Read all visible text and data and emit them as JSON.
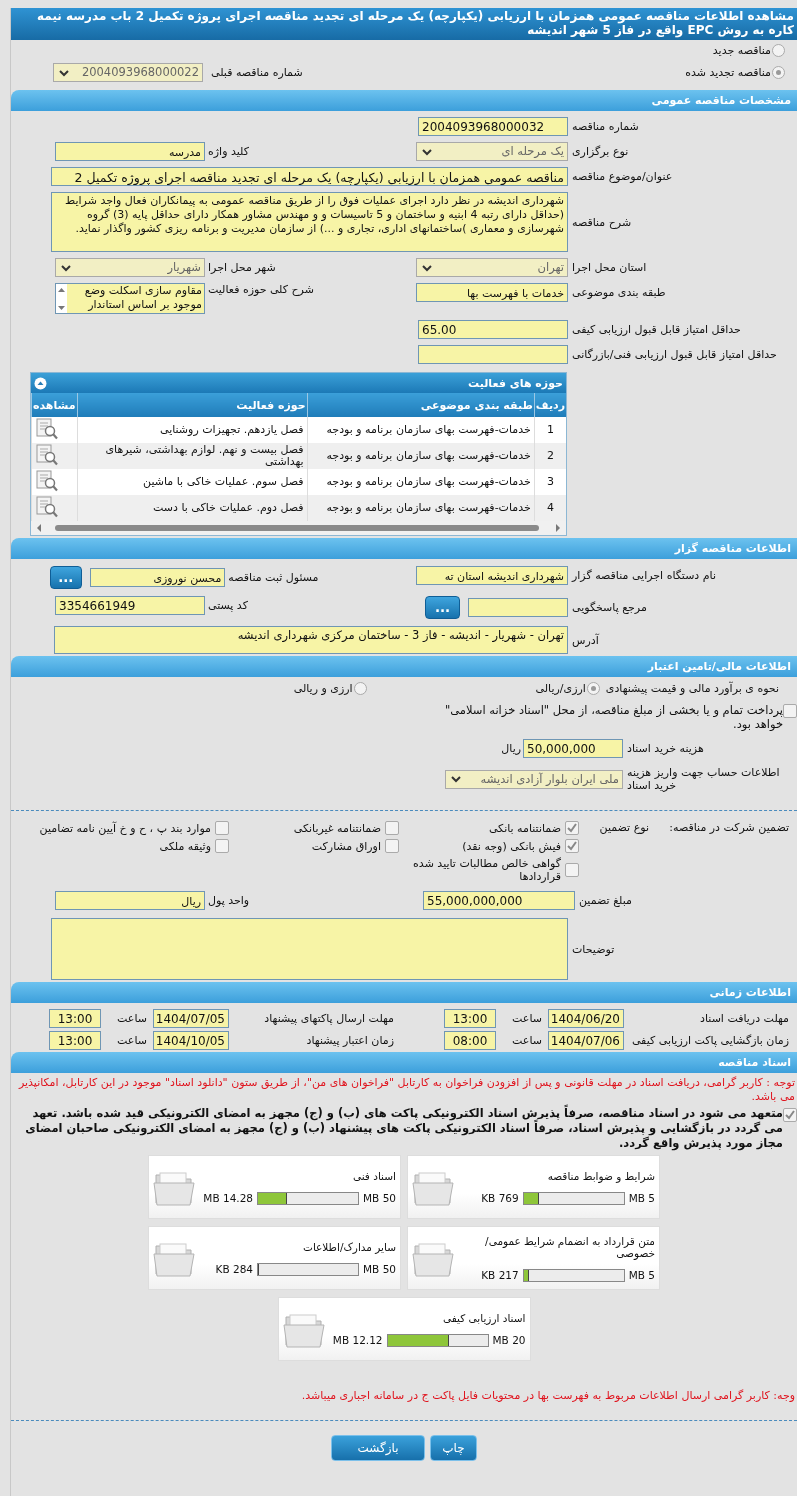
{
  "header": {
    "title": "مشاهده اطلاعات مناقصه عمومی همزمان با ارزیابی (یکپارچه) یک مرحله ای تجدید مناقصه اجرای پروژه تکمیل 2 باب مدرسه نیمه کاره به روش EPC واقع در فاز 5 شهر اندیشه"
  },
  "tender_status": {
    "options": [
      {
        "label": "مناقصه جدید",
        "selected": false
      },
      {
        "label": "مناقصه تجدید شده",
        "selected": true
      }
    ],
    "previous_label": "شماره مناقصه قبلی",
    "previous_value": "2004093968000022"
  },
  "general": {
    "title": "مشخصات مناقصه عمومی",
    "rows": [
      [
        {
          "label": "شماره مناقصه",
          "value": "2004093968000032",
          "kind": "number"
        }
      ],
      [
        {
          "label": "نوع برگزاری",
          "value": "یک مرحله ای",
          "kind": "select"
        },
        {
          "label": "کلید واژه",
          "value": "مدرسه",
          "kind": "text"
        }
      ],
      [
        {
          "label": "عنوان/موضوع مناقصه",
          "value": "مناقصه عمومی همزمان با ارزیابی (یکپارچه) یک مرحله ای تجدید مناقصه اجرای پروژه تکمیل 2",
          "kind": "wide_text"
        }
      ],
      [
        {
          "label": "شرح مناقصه",
          "value": "شهرداری اندیشه در نظر دارد  اجرای عملیات فوق را  از طریق مناقصه عمومی به پیمانکاران فعال واجد شرایط (حداقل دارای رتبه 4 ابنیه و ساختمان و 5 تاسیسات و و مهندس مشاور همکار دارای حداقل پایه (3) گروه شهرسازی و معماری )ساختمانهای اداری، تجاری و ...) از سازمان مدیریت و برنامه ریزی کشور واگذار نماید.",
          "kind": "textarea"
        }
      ],
      [
        {
          "label": "استان محل اجرا",
          "value": "تهران",
          "kind": "select"
        },
        {
          "label": "شهر محل اجرا",
          "value": "شهریار",
          "kind": "select"
        }
      ],
      [
        {
          "label": "طبقه بندی موضوعی",
          "value": "خدمات با فهرست بها",
          "kind": "text"
        },
        {
          "label": "شرح کلی حوزه فعالیت",
          "value": "مقاوم سازی اسکلت وضع موجود بر اساس استاندار",
          "kind": "listbox"
        }
      ],
      [
        {
          "label": "حداقل امتیاز قابل قبول ارزیابی کیفی",
          "value": "65.00",
          "kind": "number"
        }
      ],
      [
        {
          "label": "حداقل امتیاز قابل قبول ارزیابی فنی/بازرگانی",
          "kind": "number"
        }
      ]
    ]
  },
  "activities": {
    "title": "حوزه های فعالیت",
    "columns": [
      "ردیف",
      "طبقه بندی موضوعی",
      "حوزه فعالیت",
      "مشاهده"
    ],
    "rows": [
      {
        "index": "1",
        "category": "خدمات-فهرست بهای سازمان برنامه و بودجه",
        "activity": "فصل یازدهم. تجهیزات روشنایی"
      },
      {
        "index": "2",
        "category": "خدمات-فهرست بهای سازمان برنامه و بودجه",
        "activity": "فصل بیست و نهم. لوازم بهداشتی، شیرهای بهداشتی"
      },
      {
        "index": "3",
        "category": "خدمات-فهرست بهای سازمان برنامه و بودجه",
        "activity": "فصل سوم. عملیات خاکی با ماشین"
      },
      {
        "index": "4",
        "category": "خدمات-فهرست بهای سازمان برنامه و بودجه",
        "activity": "فصل دوم. عملیات خاکی با دست"
      }
    ]
  },
  "organizer": {
    "title": "اطلاعات مناقصه گزار",
    "rows": [
      [
        {
          "label": "نام دستگاه اجرایی مناقصه گزار",
          "value": "شهرداری اندیشه استان ته",
          "kind": "text"
        },
        {
          "label": "مسئول ثبت مناقصه",
          "value": "محسن نوروزی",
          "kind": "text",
          "button": "..."
        }
      ],
      [
        {
          "label": "مرجع پاسخگویی",
          "kind": "text",
          "button": "..."
        },
        {
          "label": "کد پستی",
          "value": "3354661949",
          "kind": "number"
        }
      ],
      [
        {
          "label": "آدرس",
          "value": "تهران - شهریار - اندیشه - فاز 3 - ساختمان مرکزی شهرداری اندیشه",
          "kind": "wide_box"
        }
      ]
    ]
  },
  "finance": {
    "title": "اطلاعات مالی/تامین اعتبار",
    "estimate": {
      "label": "نحوه ی برآورد مالی و قیمت پیشنهادی",
      "options": [
        {
          "label": "ارزی/ریالی",
          "selected": true
        },
        {
          "label": "ارزی و ریالی",
          "selected": false
        }
      ]
    },
    "treasury": {
      "label": "پرداخت تمام و یا بخشی از مبلغ مناقصه، از محل \"اسناد خزانه اسلامی\" خواهد بود.",
      "checked": false
    },
    "rows": [
      [
        {
          "label": "هزینه خرید اسناد",
          "value": "50,000,000",
          "kind": "number",
          "suffix": "ریال"
        }
      ],
      [
        {
          "label": "اطلاعات حساب جهت واریز هزینه خرید اسناد",
          "value": "ملی ایران بلوار آزادی اندیشه",
          "kind": "select"
        }
      ]
    ]
  },
  "guarantee": {
    "label": "تضمین شرکت در مناقصه:",
    "type_label": "نوع تضمین",
    "types": [
      {
        "label": "ضمانتنامه بانکی",
        "checked": true
      },
      {
        "label": "ضمانتنامه غیربانکی",
        "checked": false
      },
      {
        "label": "موارد بند پ ، ح و خ آیین نامه تضامین",
        "checked": false
      },
      {
        "label": "فیش بانکی (وجه نقد)",
        "checked": true
      },
      {
        "label": "اوراق مشارکت",
        "checked": false
      },
      {
        "label": "وثیقه ملکی",
        "checked": false
      },
      {
        "label": "گواهی خالص مطالبات تایید شده قراردادها",
        "checked": false
      }
    ],
    "rows": [
      [
        {
          "label": "مبلغ تضمین",
          "value": "55,000,000,000",
          "kind": "number"
        },
        {
          "label": "واحد پول",
          "value": "ریال",
          "kind": "text"
        }
      ],
      [
        {
          "label": "توضیحات",
          "kind": "big_box"
        }
      ]
    ]
  },
  "schedule": {
    "title": "اطلاعات زمانی",
    "items": [
      {
        "label": "مهلت دریافت اسناد",
        "date": "1404/06/20",
        "time_label": "ساعت",
        "time": "13:00"
      },
      {
        "label": "مهلت ارسال پاکتهای پیشنهاد",
        "date": "1404/07/05",
        "time_label": "ساعت",
        "time": "13:00"
      },
      {
        "label": "زمان بازگشایی پاکت ارزیابی کیفی",
        "date": "1404/07/06",
        "time_label": "ساعت",
        "time": "08:00"
      },
      {
        "label": "زمان اعتبار پیشنهاد",
        "date": "1404/10/05",
        "time_label": "ساعت",
        "time": "13:00"
      }
    ]
  },
  "documents": {
    "title": "اسناد مناقصه",
    "note": "توجه : کاربر گرامی، دریافت اسناد در مهلت قانونی و پس از افزودن فراخوان به کارتابل \"فراخوان های من\"، از طریق ستون \"دانلود اسناد\" موجود در این کارتابل، امکانپذیر می باشد.",
    "commitment": {
      "text": "متعهد می شود در اسناد مناقصه، صرفاً پذیرش اسناد الکترونیکی پاکت های (ب) و (ج) مجهز به امضای الکترونیکی قید شده باشد. تعهد می گردد در بازگشایی و پذیرش اسناد، صرفاً اسناد الکترونیکی پاکت های پیشنهاد (ب) و (ج) مجهز به امضای الکترونیکی صاحبان امضای مجاز مورد پذیرش واقع گردد.",
      "checked": true
    },
    "files": [
      {
        "name": "شرایط و ضوابط مناقصه",
        "used": "769 KB",
        "max": "5 MB",
        "level": 0.15
      },
      {
        "name": "اسناد فنی",
        "used": "14.28 MB",
        "max": "50 MB",
        "level": 0.29
      },
      {
        "name": "متن قرارداد به انضمام شرایط عمومی/خصوصی",
        "used": "217 KB",
        "max": "5 MB",
        "level": 0.05
      },
      {
        "name": "سایر مدارک/اطلاعات",
        "used": "284 KB",
        "max": "50 MB",
        "level": 0.01
      },
      {
        "name": "اسناد ارزیابی کیفی",
        "used": "12.12 MB",
        "max": "20 MB",
        "level": 0.61
      }
    ],
    "footer_note": "وجه: کاربر گرامی ارسال اطلاعات مربوط به فهرست بها در محتویات فایل پاکت ج در سامانه اجباری میباشد."
  },
  "buttons": [
    {
      "label": "چاپ",
      "kind": "print"
    },
    {
      "label": "بازگشت",
      "kind": "back"
    }
  ]
}
